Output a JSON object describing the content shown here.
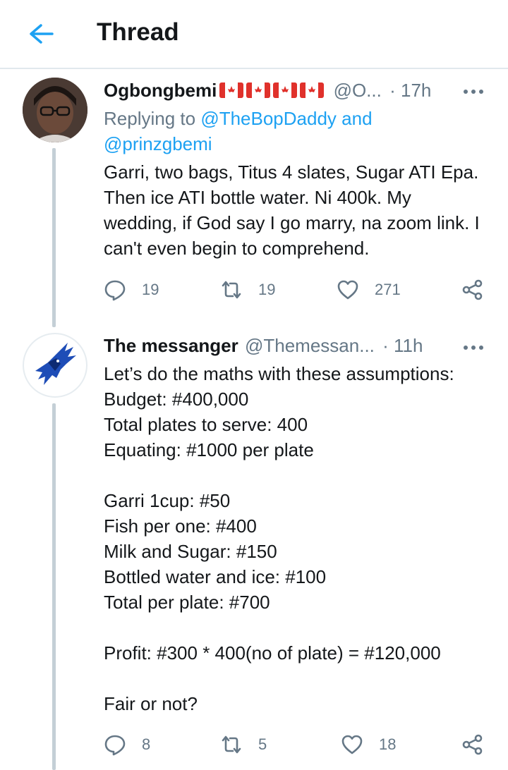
{
  "header": {
    "title": "Thread"
  },
  "tweets": [
    {
      "name": "Ogbongbemi",
      "flags": "🇨🇦🇨🇦🇨🇦🇨🇦",
      "handle": "@O...",
      "dot": "·",
      "time": "17h",
      "replying_prefix": "Replying to ",
      "replying_user1": "@TheBopDaddy",
      "replying_and": " and",
      "replying_user2": "@prinzgbemi",
      "text": "Garri, two bags, Titus 4 slates, Sugar ATI Epa. Then ice ATI bottle water. Ni 400k. My wedding, if God say I go marry, na zoom link. I can't even begin to comprehend.",
      "replies": "19",
      "retweets": "19",
      "likes": "271"
    },
    {
      "name": "The messanger",
      "handle": "@Themessan...",
      "dot": "·",
      "time": "11h",
      "text": "Let’s do the maths with these assumptions:\nBudget: #400,000\nTotal plates to serve: 400\nEquating: #1000 per plate\n\nGarri 1cup: #50\nFish per one: #400\nMilk and Sugar: #150\nBottled water and ice: #100\nTotal per plate: #700\n\nProfit: #300 * 400(no of plate) = #120,000\n\nFair or not?",
      "replies": "8",
      "retweets": "5",
      "likes": "18"
    }
  ],
  "colors": {
    "accent": "#1da1f2",
    "muted": "#657786",
    "thread_line": "#c4cfd6"
  },
  "icons": [
    "back-arrow-icon",
    "more-icon",
    "reply-icon",
    "retweet-icon",
    "like-icon",
    "share-icon"
  ]
}
